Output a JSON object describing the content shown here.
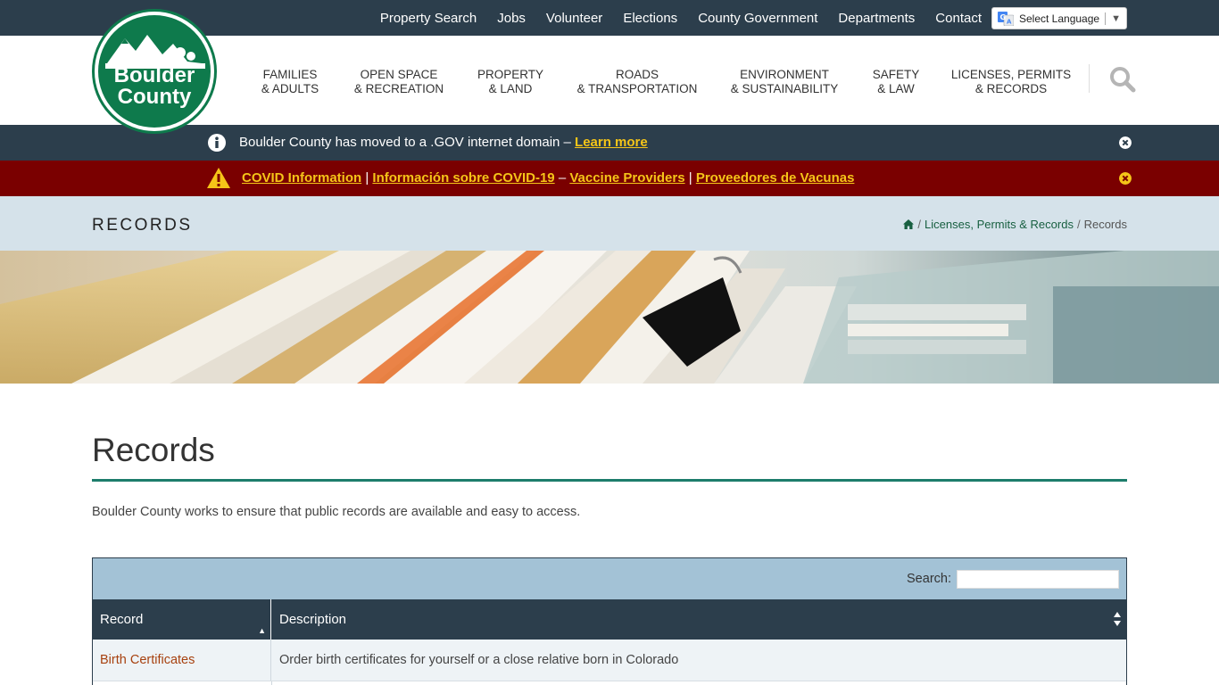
{
  "topnav": [
    {
      "label": "Property Search"
    },
    {
      "label": "Jobs"
    },
    {
      "label": "Volunteer"
    },
    {
      "label": "Elections"
    },
    {
      "label": "County Government"
    },
    {
      "label": "Departments"
    },
    {
      "label": "Contact"
    }
  ],
  "language": {
    "label": "Select Language",
    "arrow": "▼"
  },
  "logo": {
    "line1": "Boulder",
    "line2": "County"
  },
  "mainnav": [
    {
      "line1": "Families",
      "line2": "& Adults"
    },
    {
      "line1": "Open Space",
      "line2": "& Recreation"
    },
    {
      "line1": "Property",
      "line2": "& Land"
    },
    {
      "line1": "Roads",
      "line2": "& Transportation"
    },
    {
      "line1": "Environment",
      "line2": "& Sustainability"
    },
    {
      "line1": "Safety",
      "line2": "& Law"
    },
    {
      "line1": "Licenses, Permits",
      "line2": "& Records"
    }
  ],
  "alerts": {
    "domain": {
      "text": "Boulder County has moved to a .GOV internet domain – ",
      "link": "Learn more"
    },
    "covid": {
      "link1": "COVID Information",
      "sep1": "|",
      "link2": "Información sobre COVID-19",
      "sep2": "–",
      "link3": "Vaccine Providers",
      "sep3": "|",
      "link4": "Proveedores de Vacunas"
    }
  },
  "band": {
    "title": "RECORDS",
    "breadcrumbs": {
      "parent": "Licenses, Permits & Records",
      "current": "Records",
      "sep": "/"
    }
  },
  "page": {
    "title": "Records",
    "intro": "Boulder County works to ensure that public records are available and easy to access."
  },
  "table": {
    "search_label": "Search:",
    "search_value": "",
    "columns": [
      "Record",
      "Description"
    ],
    "rows": [
      {
        "record": "Birth Certificates",
        "description": "Order birth certificates for yourself or a close relative born in Colorado"
      }
    ]
  },
  "colors": {
    "dark_navy": "#2c3e4c",
    "brand_green": "#0e7a4c",
    "alert_red": "#7a0000",
    "link_yellow": "#f5c518",
    "teal_rule": "#1d7d6c",
    "band_blue": "#d5e2ea",
    "record_link": "#a7410f"
  },
  "icons": {
    "info": "info-circle-icon",
    "warning": "warning-triangle-icon",
    "close": "close-circle-icon",
    "search": "search-icon",
    "home": "home-icon",
    "translate": "google-translate-icon"
  }
}
